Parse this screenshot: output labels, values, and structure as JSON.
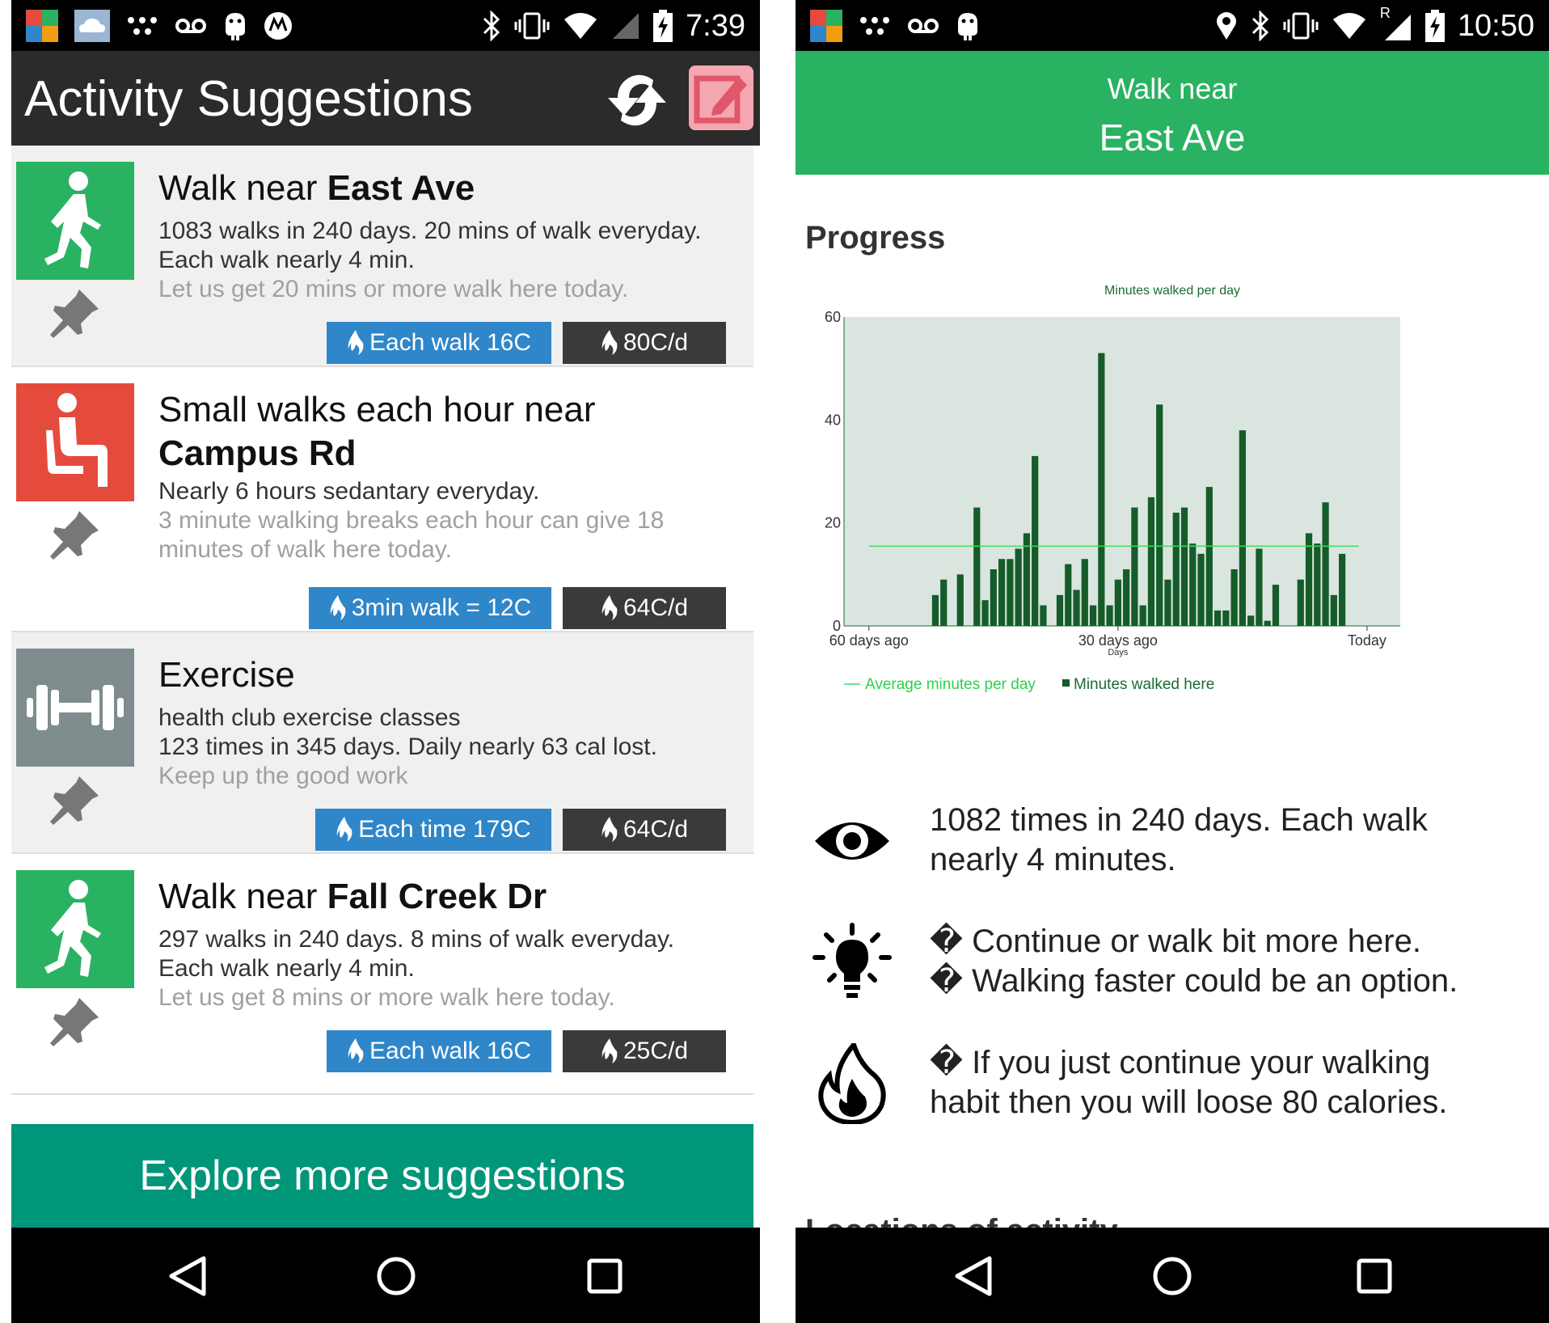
{
  "left": {
    "status": {
      "time": "7:39"
    },
    "appbar": {
      "title": "Activity Suggestions"
    },
    "cards": [
      {
        "title_pre": "Walk near ",
        "title_bold": "East Ave",
        "lines": [
          "1083 walks in 240 days. 20 mins of walk everyday.",
          "Each walk nearly 4 min."
        ],
        "muted": [
          "Let us get 20 mins or more walk here today."
        ],
        "badge_blue": "Each walk 16C",
        "badge_dark": "80C/d",
        "icon": "walking-person-icon",
        "color": "#29b261"
      },
      {
        "title_pre": "Small walks each hour near ",
        "title_bold": "Campus Rd",
        "lines": [
          "Nearly 6 hours sedantary everyday."
        ],
        "muted": [
          "3 minute walking breaks each hour can give 18",
          "minutes of walk here today."
        ],
        "badge_blue": "3min walk = 12C",
        "badge_dark": "64C/d",
        "icon": "seated-person-icon",
        "color": "#e54b3c"
      },
      {
        "title_pre": "Exercise",
        "title_bold": "",
        "lines": [
          "health club exercise classes",
          "123 times in 345 days. Daily nearly 63 cal lost."
        ],
        "muted": [
          "Keep up the good work"
        ],
        "badge_blue": "Each time 179C",
        "badge_dark": "64C/d",
        "icon": "dumbbell-icon",
        "color": "#7f8c8d"
      },
      {
        "title_pre": "Walk near ",
        "title_bold": "Fall Creek Dr",
        "lines": [
          "297 walks in 240 days. 8 mins of walk everyday.",
          "Each walk nearly 4 min."
        ],
        "muted": [
          "Let us get 8 mins or more walk here today."
        ],
        "badge_blue": "Each walk 16C",
        "badge_dark": "25C/d",
        "icon": "walking-person-icon",
        "color": "#29b261"
      }
    ],
    "explore_label": "Explore more suggestions"
  },
  "right": {
    "status": {
      "time": "10:50",
      "roaming": "R"
    },
    "header": {
      "sub": "Walk near",
      "main": "East Ave"
    },
    "progress_title": "Progress",
    "info": [
      {
        "icon": "eye-icon",
        "lines": [
          "1082 times in 240 days. Each walk",
          "nearly 4 minutes."
        ]
      },
      {
        "icon": "lightbulb-icon",
        "lines": [
          "� Continue or walk bit more here.",
          "� Walking faster could be an option."
        ]
      },
      {
        "icon": "flame-icon",
        "lines": [
          "� If you just continue your walking",
          "habit then you will loose 80 calories."
        ]
      }
    ],
    "cutoff_text": "Locations of activity"
  },
  "chart_data": {
    "type": "bar",
    "title": "Minutes walked per day",
    "xlabel": "Days",
    "ylabel": "",
    "ylim": [
      0,
      60
    ],
    "yticks": [
      0,
      20,
      40,
      60
    ],
    "xtick_labels": [
      "60 days ago",
      "30 days ago",
      "Today"
    ],
    "xtick_positions": [
      0,
      30,
      60
    ],
    "average": {
      "name": "Average minutes per day",
      "value": 15.5,
      "x_range": [
        0,
        59
      ]
    },
    "series": [
      {
        "name": "Minutes walked here",
        "x": [
          8,
          9,
          11,
          13,
          14,
          15,
          16,
          17,
          18,
          19,
          20,
          21,
          23,
          24,
          25,
          26,
          27,
          28,
          29,
          30,
          31,
          32,
          33,
          34,
          35,
          36,
          37,
          38,
          39,
          40,
          41,
          42,
          43,
          44,
          45,
          46,
          47,
          48,
          49,
          52,
          53,
          54,
          55,
          56,
          57,
          59
        ],
        "values": [
          6,
          9,
          10,
          23,
          5,
          11,
          13,
          13,
          15,
          18,
          33,
          4,
          6,
          12,
          7,
          13,
          4,
          53,
          4,
          9,
          11,
          23,
          4,
          25,
          43,
          9,
          22,
          23,
          16,
          14,
          27,
          3,
          3,
          11,
          38,
          2,
          15,
          1,
          8,
          9,
          18,
          16,
          24,
          6,
          14,
          0
        ]
      }
    ],
    "legend": "bottom"
  },
  "colors": {
    "green_header": "#29b261",
    "bar": "#155c2a",
    "plot_bg": "#dbe5df",
    "teal_button": "#00967a",
    "badge_blue": "#2f86c9",
    "badge_dark": "#3a3a3a"
  }
}
